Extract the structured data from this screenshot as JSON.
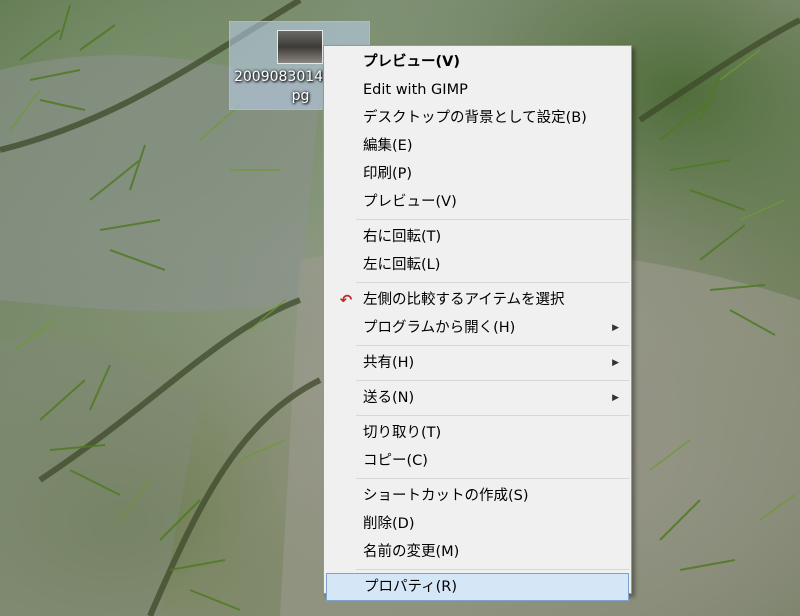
{
  "desktop_icon": {
    "label": "20090830145108.jpg"
  },
  "context_menu": {
    "groups": [
      [
        {
          "label": "プレビュー(V)",
          "bold": true
        },
        {
          "label": "Edit with GIMP"
        },
        {
          "label": "デスクトップの背景として設定(B)"
        },
        {
          "label": "編集(E)"
        },
        {
          "label": "印刷(P)"
        },
        {
          "label": "プレビュー(V)"
        }
      ],
      [
        {
          "label": "右に回転(T)"
        },
        {
          "label": "左に回転(L)"
        }
      ],
      [
        {
          "label": "左側の比較するアイテムを選択",
          "icon": "compare-arrow-icon"
        },
        {
          "label": "プログラムから開く(H)",
          "submenu": true
        }
      ],
      [
        {
          "label": "共有(H)",
          "submenu": true
        }
      ],
      [
        {
          "label": "送る(N)",
          "submenu": true
        }
      ],
      [
        {
          "label": "切り取り(T)"
        },
        {
          "label": "コピー(C)"
        }
      ],
      [
        {
          "label": "ショートカットの作成(S)"
        },
        {
          "label": "削除(D)"
        },
        {
          "label": "名前の変更(M)"
        }
      ],
      [
        {
          "label": "プロパティ(R)",
          "highlight": true
        }
      ]
    ]
  },
  "colors": {
    "menu_background": "#f0f0f0",
    "menu_highlight": "#d5e6f7",
    "icon_accent": "#c0282c"
  }
}
